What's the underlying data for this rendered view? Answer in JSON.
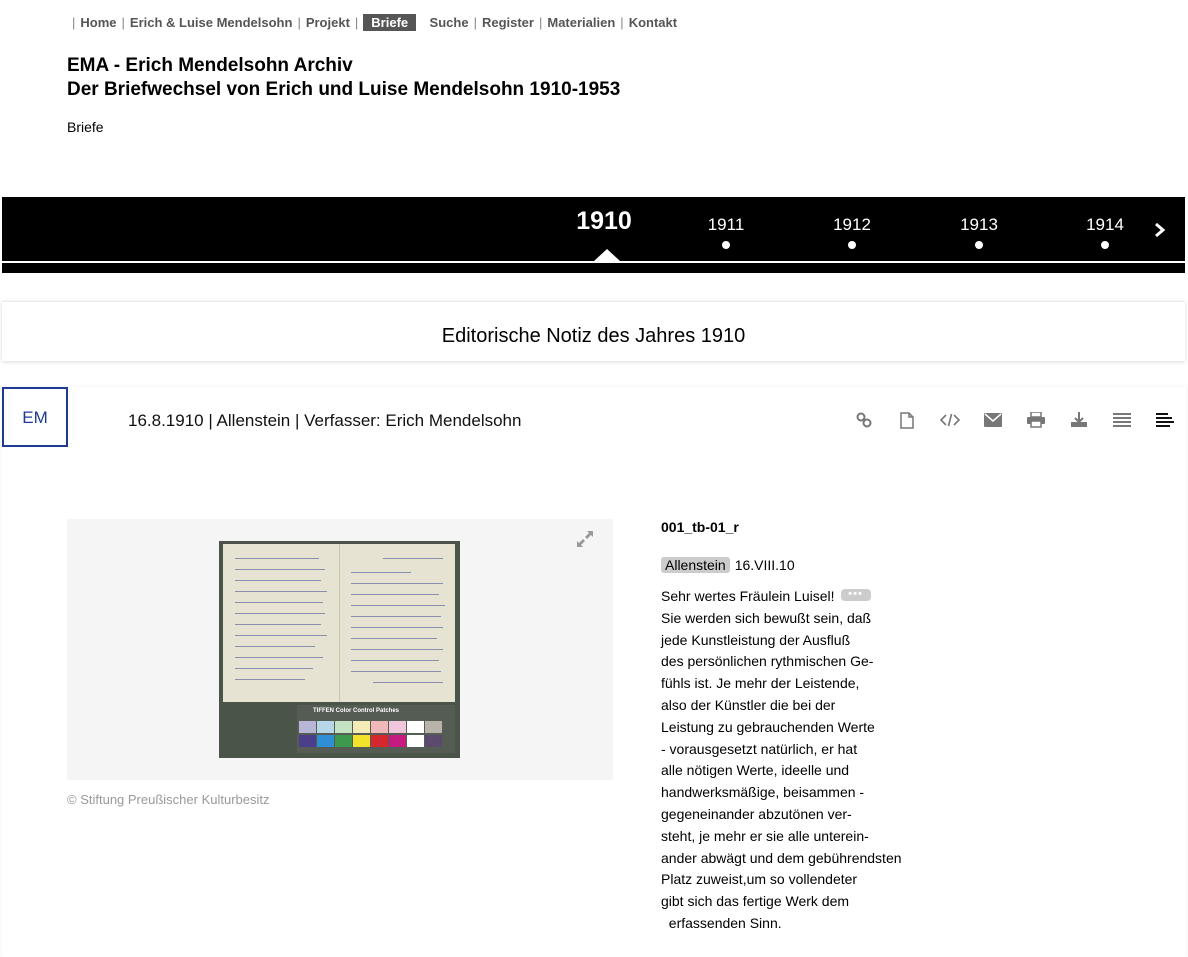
{
  "nav": {
    "items": [
      {
        "label": "Home",
        "active": false
      },
      {
        "label": "Erich & Luise Mendelsohn",
        "active": false
      },
      {
        "label": "Projekt",
        "active": false
      },
      {
        "label": "Briefe",
        "active": true
      },
      {
        "label": "Suche",
        "active": false
      },
      {
        "label": "Register",
        "active": false
      },
      {
        "label": "Materialien",
        "active": false
      },
      {
        "label": "Kontakt",
        "active": false
      }
    ]
  },
  "header": {
    "title_line1": "EMA - Erich Mendelsohn Archiv",
    "title_line2": "Der Briefwechsel von Erich und Luise Mendelsohn 1910-1953",
    "subtitle": "Briefe"
  },
  "timeline": {
    "selected": "1910",
    "years": [
      "1911",
      "1912",
      "1913",
      "1914"
    ]
  },
  "notice": {
    "label": "Editorische Notiz des Jahres 1910"
  },
  "letter": {
    "badge": "EM",
    "meta": "16.8.1910 | Allenstein | Verfasser: Erich Mendelsohn",
    "tools": [
      "link-icon",
      "file-icon",
      "code-icon",
      "mail-icon",
      "print-icon",
      "download-icon",
      "list-icon",
      "align-left-icon"
    ],
    "copyright": "© Stiftung Preußischer Kulturbesitz",
    "file_id": "001_tb-01_r",
    "place": "Allenstein",
    "date": "16.VIII.10",
    "greeting": "Sehr wertes Fräulein Luisel!",
    "more_label": "•••",
    "lines": [
      "Sie werden sich bewußt sein, daß",
      "jede Kunstleistung der Ausfluß",
      "des persönlichen rythmischen Ge-",
      "fühls ist. Je mehr der Leistende,",
      "also der Künstler die bei der",
      "Leistung zu gebrauchenden Werte",
      "- vorausgesetzt natürlich, er hat",
      "alle nötigen Werte, ideelle und",
      "handwerksmäßige, beisammen -",
      "gegeneinander abzutönen ver-",
      "steht, je mehr er sie alle unterein-",
      "ander abwägt und dem gebührendsten",
      "Platz zuweist,um so vollendeter",
      "gibt sich das fertige Werk dem",
      "  erfassenden Sinn."
    ],
    "scan_colorchart_label": "TIFFEN Color Control Patches"
  }
}
